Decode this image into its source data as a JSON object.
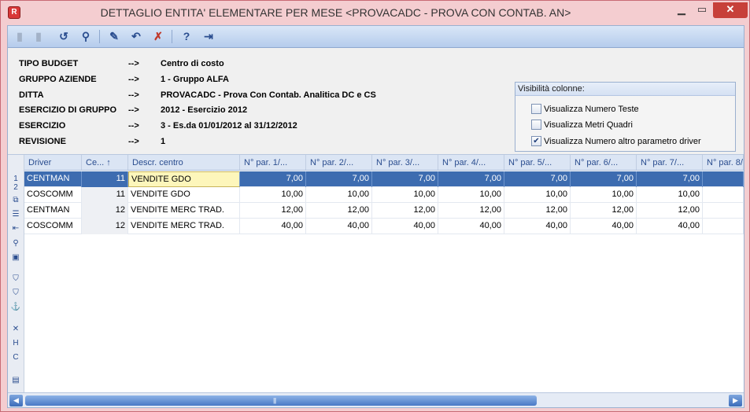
{
  "window": {
    "title": "DETTAGLIO ENTITA' ELEMENTARE PER MESE <PROVACADC - PROVA CON CONTAB. AN>",
    "min_label": "▁",
    "max_label": "▭",
    "close_label": "✕",
    "app_icon": "R"
  },
  "toolbar": {
    "new_icon": "▮",
    "delete_icon": "▮",
    "refresh_icon": "↺",
    "find_icon": "⚲",
    "edit_icon": "✎",
    "undo_icon": "↶",
    "cancel_icon": "✗",
    "help_icon": "?",
    "exit_icon": "⇥"
  },
  "info": {
    "rows": [
      {
        "label": "TIPO BUDGET",
        "arrow": "-->",
        "value": "Centro di costo"
      },
      {
        "label": "GRUPPO AZIENDE",
        "arrow": "-->",
        "value": "1 - Gruppo ALFA"
      },
      {
        "label": "DITTA",
        "arrow": "-->",
        "value": "PROVACADC - Prova Con Contab. Analitica DC e CS"
      },
      {
        "label": "ESERCIZIO DI GRUPPO",
        "arrow": "-->",
        "value": "2012 - Esercizio 2012"
      },
      {
        "label": "ESERCIZIO",
        "arrow": "-->",
        "value": "3 - Es.da 01/01/2012 al 31/12/2012"
      },
      {
        "label": "REVISIONE",
        "arrow": "-->",
        "value": "1"
      }
    ]
  },
  "colvis": {
    "title": "Visibilità colonne:",
    "options": [
      {
        "label": "Visualizza Numero Teste",
        "checked": false,
        "mark": ""
      },
      {
        "label": "Visualizza Metri Quadri",
        "checked": false,
        "mark": ""
      },
      {
        "label": "Visualizza Numero altro parametro driver",
        "checked": true,
        "mark": "✔"
      }
    ]
  },
  "grid": {
    "row_numbers": [
      "1",
      "2"
    ],
    "side_icons": [
      "⧉",
      "☰",
      "⇤",
      "⚲",
      "▣",
      "⛉",
      "⛉",
      "⚓",
      "✕",
      "H",
      "C",
      "▤"
    ],
    "headers": [
      "Driver",
      "Ce... ↑",
      "Descr. centro",
      "N° par. 1/...",
      "N° par. 2/...",
      "N° par. 3/...",
      "N° par. 4/...",
      "N° par. 5/...",
      "N° par. 6/...",
      "N° par. 7/...",
      "N° par. 8/"
    ],
    "rows": [
      {
        "driver": "CENTMAN",
        "ce": "11",
        "descr": "VENDITE GDO",
        "p1": "7,00",
        "p2": "7,00",
        "p3": "7,00",
        "p4": "7,00",
        "p5": "7,00",
        "p6": "7,00",
        "p7": "7,00",
        "selected": true
      },
      {
        "driver": "COSCOMM",
        "ce": "11",
        "descr": "VENDITE GDO",
        "p1": "10,00",
        "p2": "10,00",
        "p3": "10,00",
        "p4": "10,00",
        "p5": "10,00",
        "p6": "10,00",
        "p7": "10,00",
        "selected": false
      },
      {
        "driver": "CENTMAN",
        "ce": "12",
        "descr": "VENDITE MERC TRAD.",
        "p1": "12,00",
        "p2": "12,00",
        "p3": "12,00",
        "p4": "12,00",
        "p5": "12,00",
        "p6": "12,00",
        "p7": "12,00",
        "selected": false
      },
      {
        "driver": "COSCOMM",
        "ce": "12",
        "descr": "VENDITE MERC TRAD.",
        "p1": "40,00",
        "p2": "40,00",
        "p3": "40,00",
        "p4": "40,00",
        "p5": "40,00",
        "p6": "40,00",
        "p7": "40,00",
        "selected": false
      }
    ]
  },
  "scroll": {
    "left": "◀",
    "right": "▶",
    "grip": "|||"
  }
}
